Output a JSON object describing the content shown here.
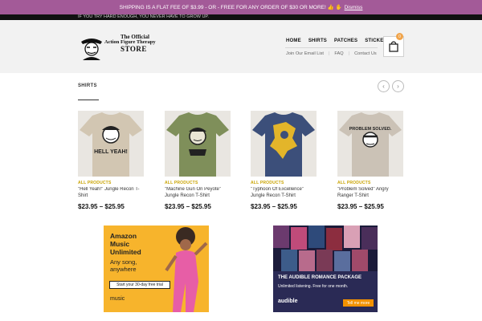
{
  "notice": {
    "text": "SHIPPING IS A FLAT FEE OF $3.99 - OR - FREE FOR ANY ORDER OF $30 OR MORE! 👍 ✋",
    "dismiss": "Dismiss",
    "color": "#a35a98"
  },
  "topstrip": {
    "text": "IF YOU TRY HARD ENOUGH, YOU NEVER HAVE TO GROW UP."
  },
  "logo": {
    "line1": "The Official",
    "line2": "Action Figure Therapy",
    "line3": "STORE"
  },
  "nav": {
    "items": [
      "HOME",
      "SHIRTS",
      "PATCHES",
      "STICKERS"
    ],
    "sub": [
      "Join Our Email List",
      "FAQ",
      "Contact Us"
    ]
  },
  "cart": {
    "count": "0",
    "icon": "shopping-bag-icon"
  },
  "section": {
    "title": "SHIRTS",
    "prev_icon": "chevron-left-icon",
    "next_icon": "chevron-right-icon"
  },
  "products": [
    {
      "category": "ALL PRODUCTS",
      "name": "\"Hell Yeah!\" Jungle Recon T-Shirt",
      "price": "$23.95 – $25.95",
      "shirt_color": "#d2c6b2",
      "print": "HELL YEAH!"
    },
    {
      "category": "ALL PRODUCTS",
      "name": "\"Machine Gun On Peyote\" Jungle Recon T-Shirt",
      "price": "$23.95 – $25.95",
      "shirt_color": "#7f8f5a",
      "print": ""
    },
    {
      "category": "ALL PRODUCTS",
      "name": "\"Typhoon Of Excellence\" Jungle Recon T-Shirt",
      "price": "$23.95 – $25.95",
      "shirt_color": "#3c4f7a",
      "print": ""
    },
    {
      "category": "ALL PRODUCTS",
      "name": "\"Problem Solved\" Angry Ranger T-Shirt",
      "price": "$23.95 – $25.95",
      "shirt_color": "#cbc2b6",
      "print": "PROBLEM SOLVED."
    }
  ],
  "ads": {
    "amazon": {
      "title": "Amazon Music Unlimited",
      "tag": "Any song, anywhere",
      "cta": "Start your 30-day free trial",
      "brand": "music"
    },
    "audible": {
      "title": "THE AUDIBLE ROMANCE PACKAGE",
      "tag": "Unlimited listening. Free for one month.",
      "brand": "audible",
      "cta": "Tell me more"
    }
  }
}
